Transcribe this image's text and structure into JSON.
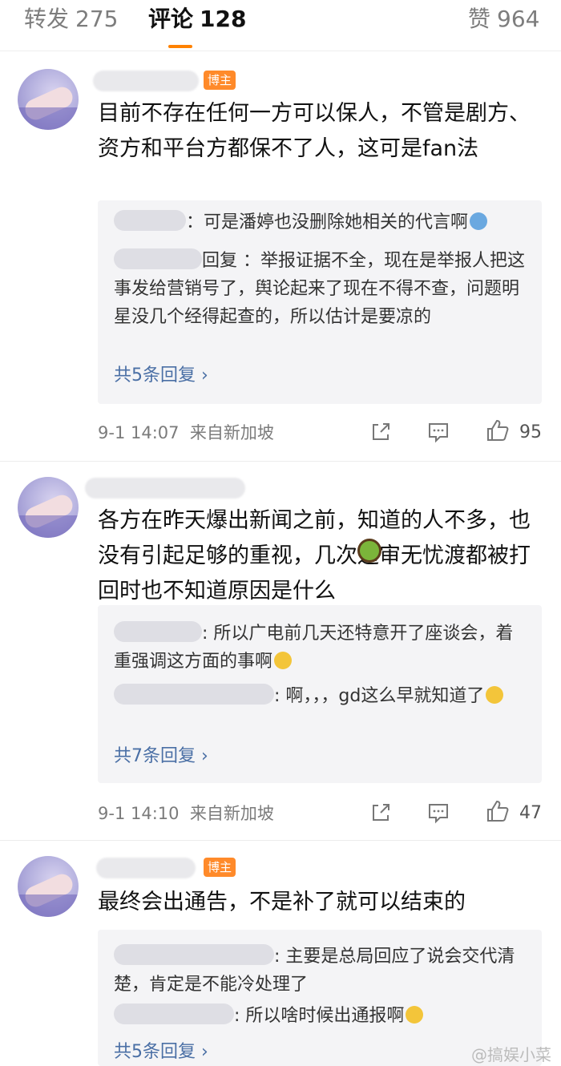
{
  "tabs": [
    {
      "label": "转发",
      "count": "275"
    },
    {
      "label": "评论",
      "count": "128"
    },
    {
      "label": "赞",
      "count": "964"
    }
  ],
  "comments": [
    {
      "badge": "博主",
      "text": "目前不存在任何一方可以保人，不管是剧方、资方和平台方都保不了人，这可是fan法",
      "replies": [
        "：可是潘婷也没删除她相关的代言啊",
        "回复 ：举报证据不全，现在是举报人把这事发给营销号了，舆论起来了现在不得不查，问题明星没几个经得起查的，所以估计是要凉的"
      ],
      "more": "共5条回复 ›",
      "time": "9-1 14:07",
      "source": "来自新加坡",
      "likes": "95"
    },
    {
      "badge": "",
      "text": "各方在昨天爆出新闻之前，知道的人不多，也没有引起足够的重视，几次送审无忧渡都被打回时也不知道原因是什么",
      "replies": [
        ": 所以广电前几天还特意开了座谈会，着重强调这方面的事啊",
        ": 啊，，，gd这么早就知道了"
      ],
      "more": "共7条回复 ›",
      "time": "9-1 14:10",
      "source": "来自新加坡",
      "likes": "47"
    },
    {
      "badge": "博主",
      "text": "最终会出通告，不是补了就可以结束的",
      "replies": [
        ": 主要是总局回应了说会交代清楚，肯定是不能冷处理了",
        ": 所以啥时候出通报啊"
      ],
      "more": "共5条回复 ›",
      "time": "",
      "source": "",
      "likes": ""
    }
  ],
  "watermark": "@搞娱小菜",
  "icons": [
    "share-icon",
    "comment-icon",
    "like-icon"
  ],
  "colors": {
    "accent": "#ff8200",
    "badge": "#ff8a2a",
    "link": "#4a6fa5"
  }
}
